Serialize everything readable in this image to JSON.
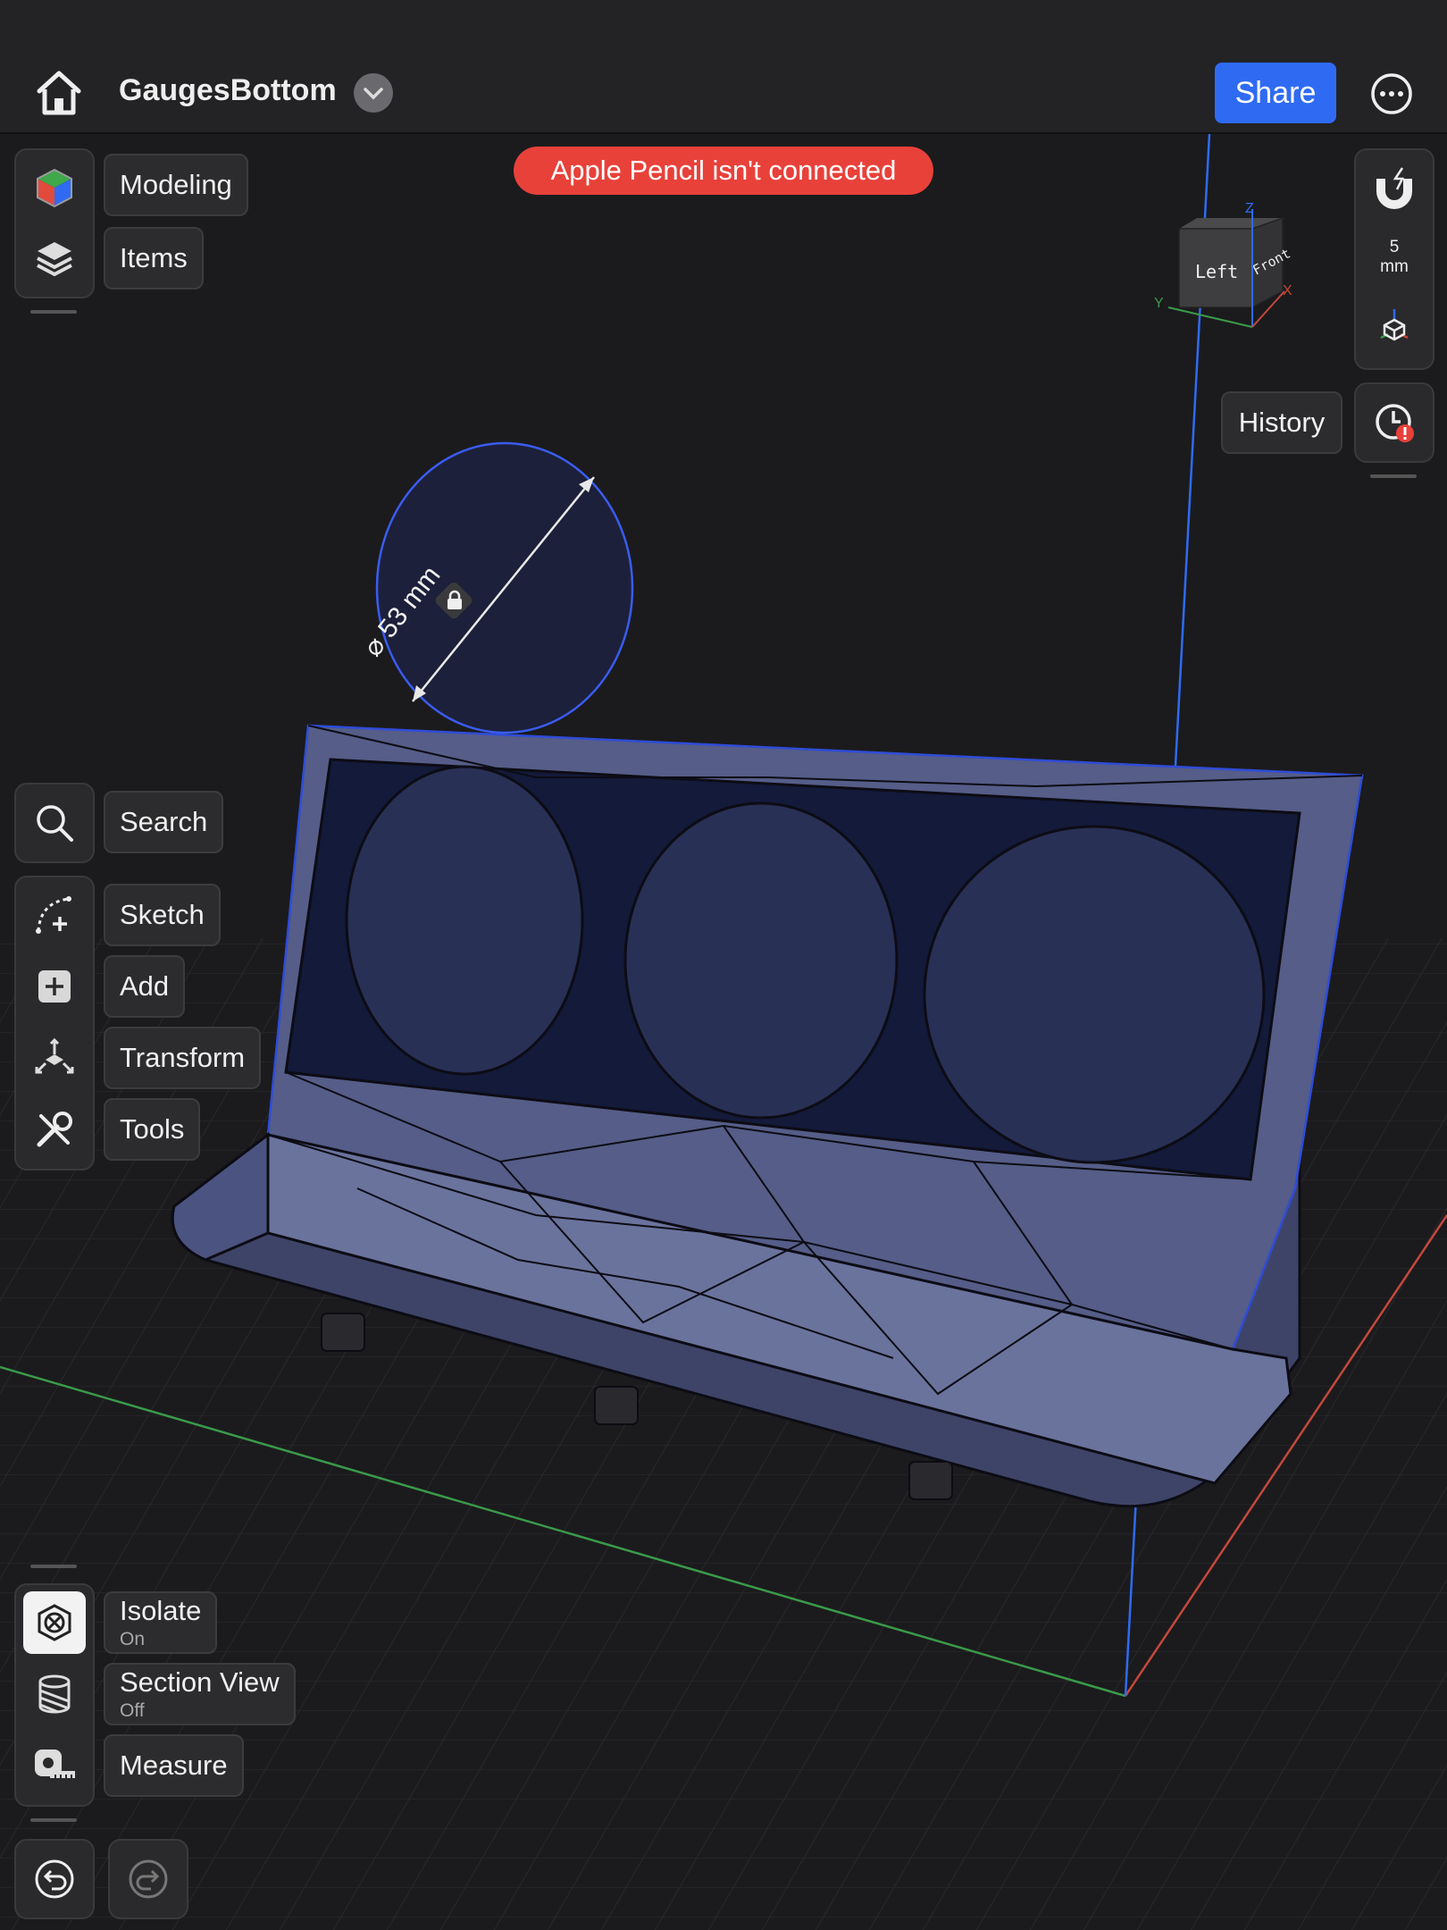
{
  "header": {
    "title": "GaugesBottom",
    "share_label": "Share"
  },
  "notification": {
    "text": "Apple Pencil isn't connected"
  },
  "left_top_tools": [
    {
      "label": "Modeling",
      "icon": "modeling-cube-icon"
    },
    {
      "label": "Items",
      "icon": "layers-icon"
    }
  ],
  "left_mid_tools": {
    "search": {
      "label": "Search",
      "icon": "search-icon"
    },
    "items": [
      {
        "label": "Sketch",
        "icon": "sketch-icon"
      },
      {
        "label": "Add",
        "icon": "add-icon"
      },
      {
        "label": "Transform",
        "icon": "transform-icon"
      },
      {
        "label": "Tools",
        "icon": "tools-icon"
      }
    ]
  },
  "left_bottom_tools": [
    {
      "label": "Isolate",
      "state": "On",
      "icon": "isolate-icon"
    },
    {
      "label": "Section View",
      "state": "Off",
      "icon": "section-view-icon"
    },
    {
      "label": "Measure",
      "state": "",
      "icon": "measure-tape-icon"
    }
  ],
  "right_panel": {
    "snap_value": "5",
    "snap_unit": "mm",
    "history_label": "History"
  },
  "view_cube": {
    "faces": [
      "Left",
      "Front"
    ],
    "axes": [
      "Z",
      "Y",
      "X"
    ]
  },
  "dimension": {
    "label": "⌀ 53 mm"
  },
  "colors": {
    "accent": "#2f6bf2",
    "alert": "#e8413a",
    "model": "#5a6490",
    "axis_x": "#c4483c",
    "axis_y": "#3a9a4a",
    "axis_z": "#2f6bf2"
  }
}
